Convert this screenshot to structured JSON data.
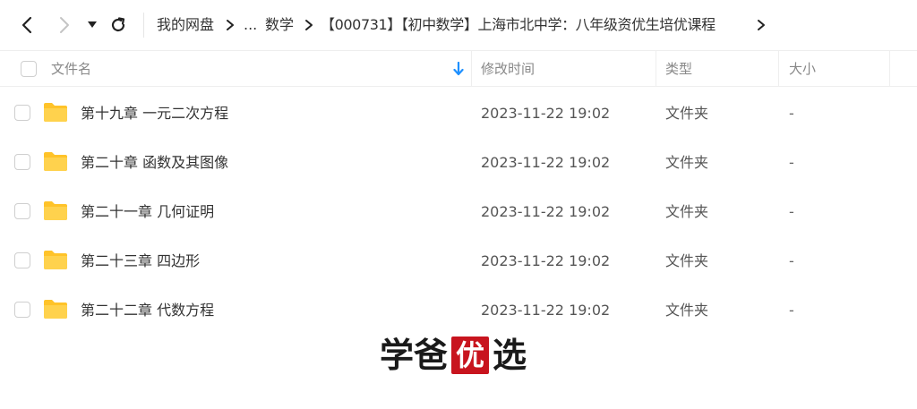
{
  "nav": {
    "back_icon": "chevron-left-icon",
    "forward_icon": "chevron-right-icon",
    "dropdown_icon": "caret-down-icon",
    "refresh_icon": "refresh-icon"
  },
  "breadcrumb": {
    "root": "我的网盘",
    "ellipsis": "...",
    "parent": "数学",
    "current": "【000731】【初中数学】上海市北中学：八年级资优生培优课程"
  },
  "table": {
    "columns": {
      "name": "文件名",
      "modified": "修改时间",
      "type": "类型",
      "size": "大小"
    },
    "sort_icon": "arrow-down-icon",
    "sort_color": "#1e90ff",
    "folder_color": "#ffc329",
    "rows": [
      {
        "name": "第十九章 一元二次方程",
        "modified": "2023-11-22 19:02",
        "type": "文件夹",
        "size": "-"
      },
      {
        "name": "第二十章 函数及其图像",
        "modified": "2023-11-22 19:02",
        "type": "文件夹",
        "size": "-"
      },
      {
        "name": "第二十一章 几何证明",
        "modified": "2023-11-22 19:02",
        "type": "文件夹",
        "size": "-"
      },
      {
        "name": "第二十三章 四边形",
        "modified": "2023-11-22 19:02",
        "type": "文件夹",
        "size": "-"
      },
      {
        "name": "第二十二章 代数方程",
        "modified": "2023-11-22 19:02",
        "type": "文件夹",
        "size": "-"
      }
    ]
  },
  "watermark": {
    "char1": "学",
    "char2": "爸",
    "seal": "优",
    "char4": "选",
    "seal_color": "#c8141e"
  }
}
